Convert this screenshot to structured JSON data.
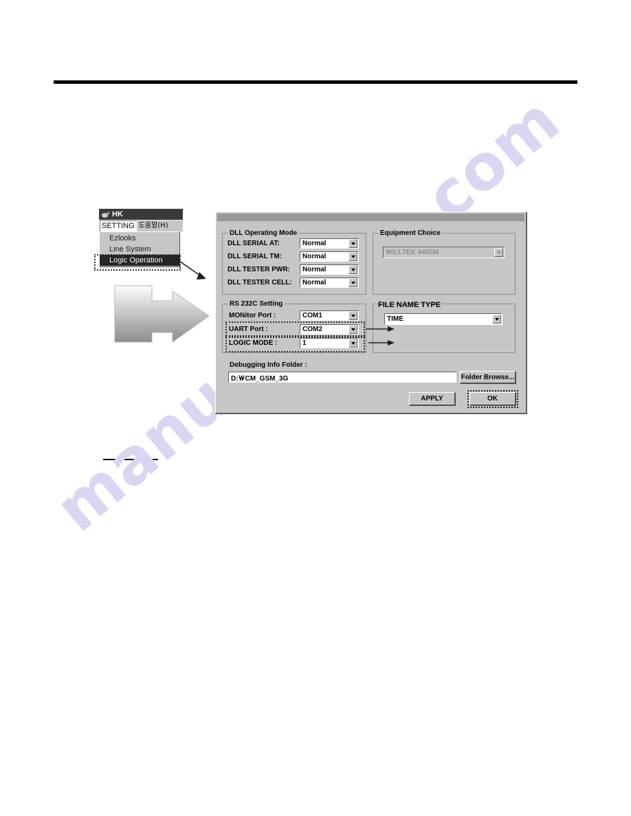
{
  "watermark": {
    "text": "manualshive.com"
  },
  "app": {
    "title": "HK",
    "icon": "app-icon",
    "menubar": [
      {
        "label": "SETTING",
        "open": true
      },
      {
        "label": "도움말(H)",
        "open": false
      }
    ],
    "dropdown": {
      "items": [
        {
          "label": "Ezlooks",
          "selected": false
        },
        {
          "label": "Line System",
          "selected": false
        },
        {
          "label": "Logic Operation",
          "selected": true
        }
      ]
    }
  },
  "dialog": {
    "title": "",
    "dll_group": {
      "title": "DLL Operating Mode",
      "rows": [
        {
          "label": "DLL SERIAL AT:",
          "value": "Normal"
        },
        {
          "label": "DLL SERIAL TM:",
          "value": "Normal"
        },
        {
          "label": "DLL TESTER PWR:",
          "value": "Normal"
        },
        {
          "label": "DLL TESTER CELL:",
          "value": "Normal"
        }
      ]
    },
    "equipment_group": {
      "title": "Equipment Choice",
      "value": "WILLTEK 4405M",
      "disabled": true
    },
    "rs232_group": {
      "title": "RS 232C Setting",
      "rows": [
        {
          "label": "MONitor Port :",
          "value": "COM1",
          "highlighted": false
        },
        {
          "label": "UART Port :",
          "value": "COM2",
          "highlighted": true
        },
        {
          "label": "LOGIC MODE :",
          "value": "1",
          "highlighted": true
        }
      ]
    },
    "filename_group": {
      "title": "FILE NAME TYPE",
      "value": "TIME"
    },
    "debug_folder": {
      "label": "Debugging Info Folder :",
      "value": "D:￦CM_GSM_3G",
      "browse_label": "Folder Browse..."
    },
    "buttons": {
      "apply_label": "APPLY",
      "ok_label": "OK"
    }
  },
  "colors": {
    "dialog_face": "#c6c6c6",
    "titlebar": "#3a3a3a",
    "selected_menu": "#262626",
    "watermark": "#d9d6f2",
    "field_white": "#ffffff",
    "disabled_text": "#8e8e8e"
  }
}
